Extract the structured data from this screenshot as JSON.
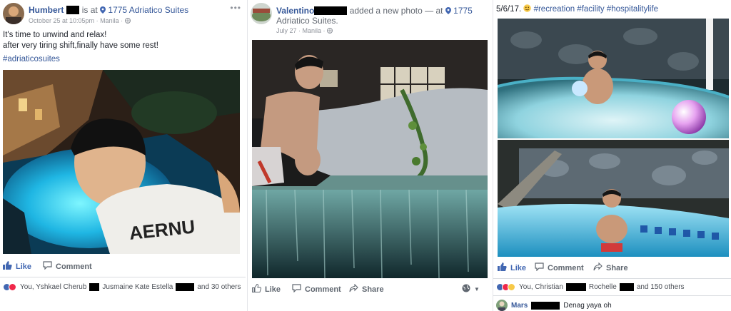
{
  "post1": {
    "author_name": "Humbert",
    "is_at": "is at",
    "place": "1775 Adriatico Suites",
    "date": "October 25 at 10:05pm",
    "location": "Manila",
    "text_line1": "It's time to unwind and relax!",
    "text_line2": "after very tiring shift,finally have some rest!",
    "hashtag": "#adriaticosuites",
    "shirt_text": "AERNU",
    "like_label": "Like",
    "comment_label": "Comment",
    "reactions_text_a": "You, Yshkael Cherub",
    "reactions_text_b": "Jusmaine Kate Estella",
    "reactions_text_c": "and 30 others"
  },
  "post2": {
    "author_name": "Valentino",
    "activity": "added a new photo — at",
    "place_line1": "1775",
    "place_line2": "Adriatico Suites.",
    "date": "July 27",
    "location": "Manila",
    "like_label": "Like",
    "comment_label": "Comment",
    "share_label": "Share"
  },
  "post3": {
    "date_text": "5/6/17.",
    "hashtags": "#recreation #facility #hospitalitylife",
    "like_label": "Like",
    "comment_label": "Comment",
    "share_label": "Share",
    "reactions_text_a": "You, Christian",
    "reactions_text_b": "Rochelle",
    "reactions_text_c": "and 150 others",
    "commenter": "Mars",
    "comment_text": "Denag yaya oh"
  },
  "colors": {
    "link_blue": "#365899",
    "like_blue": "#4267b2",
    "meta_grey": "#90949c"
  },
  "icons": [
    "location-pin-icon",
    "globe-icon",
    "more-options-icon",
    "like-thumb-icon",
    "comment-bubble-icon",
    "share-arrow-icon",
    "love-reaction-icon",
    "wow-reaction-icon",
    "emoji-icon"
  ]
}
